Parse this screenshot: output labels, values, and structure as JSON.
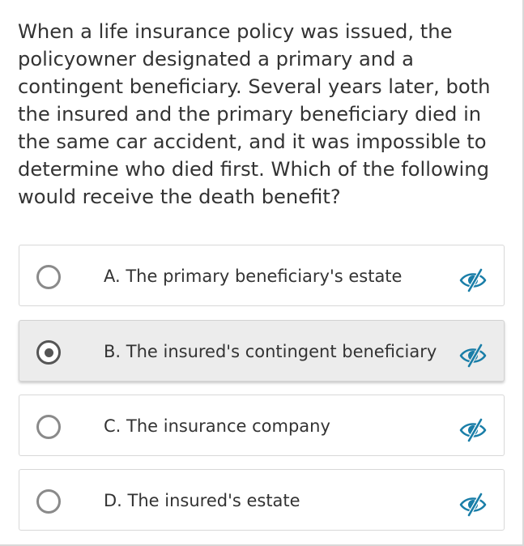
{
  "question": {
    "text": "When a life insurance policy was issued, the policyowner designated a primary and a contingent beneficiary. Several years later, both the insured and the primary beneficiary died in the same car accident, and it was impossible to determine who died first. Which of the following would receive the death benefit?"
  },
  "options": [
    {
      "label": "A. The primary beneficiary's estate",
      "selected": false,
      "action_icon": "eye-slash-icon"
    },
    {
      "label": "B. The insured's contingent beneficiary",
      "selected": true,
      "action_icon": "eye-slash-icon"
    },
    {
      "label": "C. The insurance company",
      "selected": false,
      "action_icon": "eye-slash-icon"
    },
    {
      "label": "D. The insured's estate",
      "selected": false,
      "action_icon": "eye-slash-icon"
    }
  ],
  "colors": {
    "accent": "#1a7ea8",
    "text": "#333333",
    "selected_background": "#ececec",
    "border": "#d8d8d8"
  }
}
